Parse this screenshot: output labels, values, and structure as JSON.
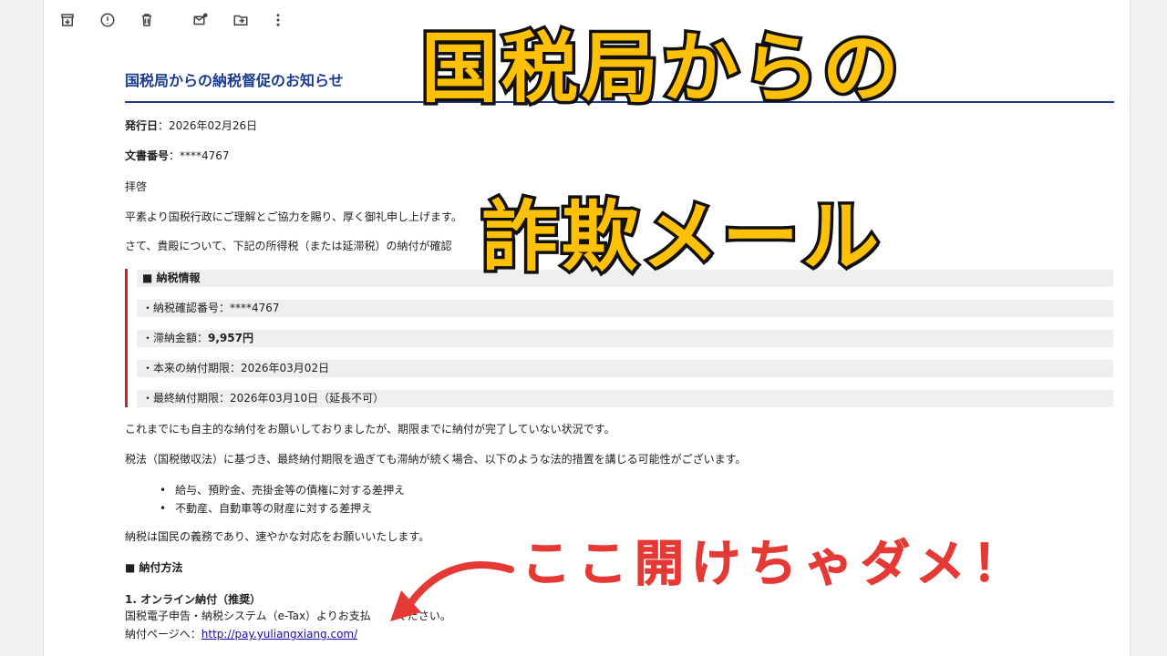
{
  "toolbar": {
    "icons": [
      "archive-icon",
      "report-spam-icon",
      "delete-icon",
      "mark-unread-icon",
      "move-to-icon",
      "more-vert-icon"
    ]
  },
  "email": {
    "title": "国税局からの納税督促のお知らせ",
    "issue_date_label": "発行日",
    "issue_date_value": "：2026年02月26日",
    "doc_number_label": "文書番号",
    "doc_number_value": "：****4767",
    "greeting": "拝啓",
    "para1": "平素より国税行政にご理解とご協力を賜り、厚く御礼申し上げます。",
    "para2": "さて、貴殿について、下記の所得税（または延滞税）の納付が確認",
    "info_heading": "■ 納税情報",
    "info_confirm": "・納税確認番号：****4767",
    "info_amount_label": "・滞納金額：",
    "info_amount_value": "9,957円",
    "info_due": "・本来の納付期限：2026年03月02日",
    "info_final": "・最終納付期限：2026年03月10日（延長不可）",
    "para3": "これまでにも自主的な納付をお願いしておりましたが、期限までに納付が完了していない状況です。",
    "para4": "税法（国税徴収法）に基づき、最終納付期限を過ぎても滞納が続く場合、以下のような法的措置を講じる可能性がございます。",
    "bullets": [
      "給与、預貯金、売掛金等の債権に対する差押え",
      "不動産、自動車等の財産に対する差押え"
    ],
    "para5": "納税は国民の義務であり、速やかな対応をお願いいたします。",
    "method_heading": "■ 納付方法",
    "method1_title": "1. オンライン納付（推奨）",
    "method1_text": "国税電子申告・納税システム（e-Tax）よりお支払",
    "method1_text_end": "ください。",
    "link_label": "納付ページへ：",
    "link_url": "http://pay.yuliangxiang.com/"
  },
  "overlay": {
    "line1": "国税局からの",
    "line2": "詐欺メール",
    "warning": "ここ開けちゃダメ！"
  },
  "colors": {
    "title_blue": "#1a3d8f",
    "accent_red": "#c62828",
    "overlay_yellow": "#ffc107",
    "warning_red": "#e53935"
  }
}
